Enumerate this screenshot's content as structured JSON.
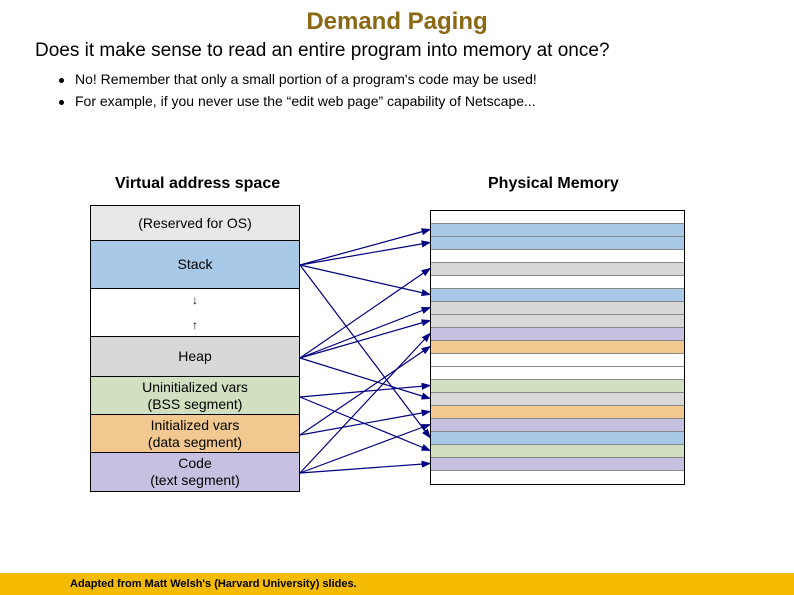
{
  "title": "Demand Paging",
  "question": "Does it make sense to read an entire program into memory at once?",
  "bullets": [
    "No! Remember that only a small portion of a program's code may be used!",
    "For example, if you never use the “edit web page” capability of Netscape..."
  ],
  "labels": {
    "vas": "Virtual address space",
    "pmem": "Physical Memory"
  },
  "segments": {
    "os": "(Reserved for OS)",
    "stack": "Stack",
    "heap": "Heap",
    "bss1": "Uninitialized vars",
    "bss2": "(BSS segment)",
    "data1": "Initialized vars",
    "data2": "(data segment)",
    "code1": "Code",
    "code2": "(text segment)"
  },
  "pmem_rows": [
    "white",
    "blue",
    "blue",
    "white",
    "gray",
    "white",
    "blue",
    "gray",
    "gray",
    "purple",
    "orange",
    "white",
    "white",
    "green",
    "gray",
    "orange",
    "purple",
    "blue",
    "green",
    "purple",
    "white"
  ],
  "footer": "Adapted from Matt Welsh's (Harvard University) slides.",
  "chart_data": {
    "type": "diagram",
    "virtual_segments": [
      {
        "name": "Reserved for OS",
        "color": "gray"
      },
      {
        "name": "Stack",
        "color": "blue"
      },
      {
        "name": "(gap)",
        "color": "white"
      },
      {
        "name": "Heap",
        "color": "gray"
      },
      {
        "name": "Uninitialized vars (BSS segment)",
        "color": "green"
      },
      {
        "name": "Initialized vars (data segment)",
        "color": "orange"
      },
      {
        "name": "Code (text segment)",
        "color": "purple"
      }
    ],
    "mappings": [
      {
        "from": "Stack",
        "to_rows": [
          1,
          2,
          6,
          17
        ]
      },
      {
        "from": "Heap",
        "to_rows": [
          4,
          7,
          8,
          14
        ]
      },
      {
        "from": "BSS",
        "to_rows": [
          13,
          18
        ]
      },
      {
        "from": "Data",
        "to_rows": [
          10,
          15
        ]
      },
      {
        "from": "Code",
        "to_rows": [
          9,
          16,
          19
        ]
      }
    ]
  }
}
